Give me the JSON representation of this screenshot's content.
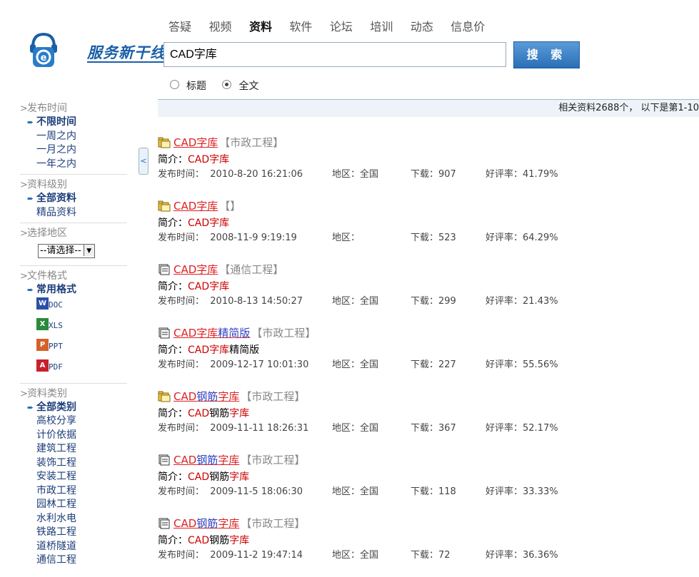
{
  "brand": {
    "name": "服务新干线"
  },
  "nav": [
    "答疑",
    "视频",
    "资料",
    "软件",
    "论坛",
    "培训",
    "动态",
    "信息价"
  ],
  "nav_active": "资料",
  "search": {
    "value": "CAD字库",
    "button": "搜 索"
  },
  "radios": [
    {
      "label": "标题",
      "checked": false
    },
    {
      "label": "全文",
      "checked": true
    }
  ],
  "result_summary": "相关资料2688个， 以下是第1-10",
  "sidebar": {
    "time": {
      "title": "发布时间",
      "items": [
        "不限时间",
        "一周之内",
        "一月之内",
        "一年之内"
      ]
    },
    "level": {
      "title": "资料级别",
      "items": [
        "全部资料",
        "精品资料"
      ]
    },
    "region": {
      "title": "选择地区",
      "select": "--请选择--"
    },
    "format": {
      "title": "文件格式",
      "selected": "常用格式",
      "items": [
        "DOC",
        "XLS",
        "PPT",
        "PDF"
      ]
    },
    "category": {
      "title": "资料类别",
      "items": [
        "全部类别",
        "高校分享",
        "计价依据",
        "建筑工程",
        "装饰工程",
        "安装工程",
        "市政工程",
        "园林工程",
        "水利水电",
        "铁路工程",
        "道桥隧道",
        "通信工程"
      ]
    }
  },
  "results": [
    {
      "icon": "folder-icon",
      "t1": "CAD字库",
      "t2": "",
      "cat": "【市政工程】",
      "d1": "CAD字库",
      "d2": "",
      "date": "2010-8-20 16:21:06",
      "region": "全国",
      "downloads": "907",
      "rating": "41.79%"
    },
    {
      "icon": "folder-icon",
      "t1": "CAD字库",
      "t2": "",
      "cat": "【】",
      "d1": "CAD字库",
      "d2": "",
      "date": "2008-11-9 9:19:19",
      "region": "",
      "downloads": "523",
      "rating": "64.29%"
    },
    {
      "icon": "document-icon",
      "t1": "CAD字库",
      "t2": "",
      "cat": "【通信工程】",
      "d1": "CAD字库",
      "d2": "",
      "date": "2010-8-13 14:50:27",
      "region": "全国",
      "downloads": "299",
      "rating": "21.43%"
    },
    {
      "icon": "document-icon",
      "t1": "CAD字库",
      "t2": "精简版",
      "cat": "【市政工程】",
      "d1": "CAD字库",
      "d2": "精简版",
      "date": "2009-12-17 10:01:30",
      "region": "全国",
      "downloads": "227",
      "rating": "55.56%"
    },
    {
      "icon": "folder-icon",
      "t1": "CAD",
      "t1b": "钢筋",
      "t1c": "字库",
      "cat": "【市政工程】",
      "d1": "CAD",
      "d1b": "钢筋",
      "d1c": "字库",
      "date": "2009-11-11 18:26:31",
      "region": "全国",
      "downloads": "367",
      "rating": "52.17%"
    },
    {
      "icon": "document-icon",
      "t1": "CAD",
      "t1b": "钢筋",
      "t1c": "字库",
      "cat": "【市政工程】",
      "d1": "CAD",
      "d1b": "钢筋",
      "d1c": "字库",
      "date": "2009-11-5 18:06:30",
      "region": "全国",
      "downloads": "118",
      "rating": "33.33%"
    },
    {
      "icon": "document-icon",
      "t1": "CAD",
      "t1b": "钢筋",
      "t1c": "字库",
      "cat": "【市政工程】",
      "d1": "CAD",
      "d1b": "钢筋",
      "d1c": "字库",
      "date": "2009-11-2 19:47:14",
      "region": "全国",
      "downloads": "72",
      "rating": "36.36%"
    }
  ],
  "labels": {
    "intro": "简介：",
    "date": "发布时间：",
    "region": "地区：",
    "downloads": "下载：",
    "rating": "好评率："
  }
}
